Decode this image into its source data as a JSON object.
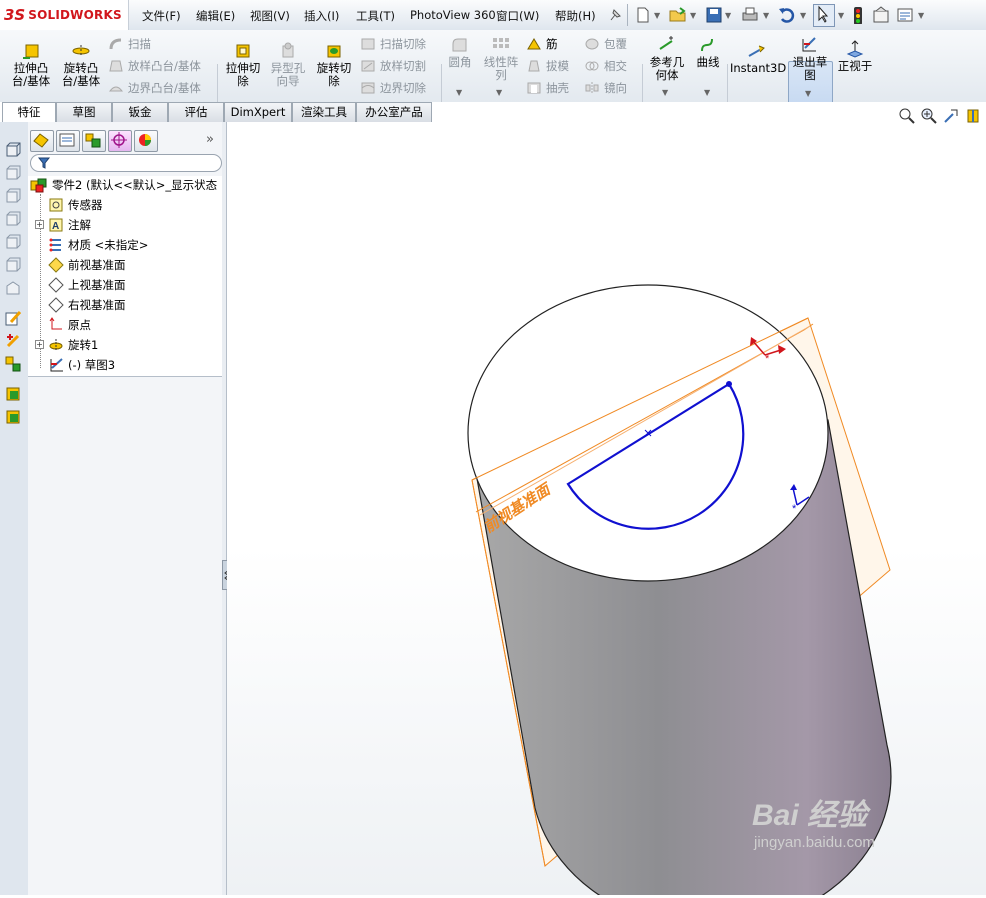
{
  "app": {
    "logo_mark": "3S",
    "brand": "SOLIDWORKS"
  },
  "menu": [
    "文件(F)",
    "编辑(E)",
    "视图(V)",
    "插入(I)",
    "工具(T)",
    "PhotoView 360",
    "窗口(W)",
    "帮助(H)"
  ],
  "ribbon": {
    "extrude_boss": "拉伸凸\n台/基体",
    "revolve_boss": "旋转凸\n台/基体",
    "sweep": "扫描",
    "loft_boss": "放样凸台/基体",
    "boundary_boss": "边界凸台/基体",
    "extrude_cut": "拉伸切\n除",
    "hole_wizard": "异型孔\n向导",
    "revolve_cut": "旋转切\n除",
    "sweep_cut": "扫描切除",
    "loft_cut": "放样切割",
    "boundary_cut": "边界切除",
    "fillet": "圆角",
    "linear_pattern": "线性阵\n列",
    "rib": "筋",
    "draft": "拔模",
    "shell": "抽壳",
    "wrap": "包覆",
    "intersect": "相交",
    "mirror": "镜向",
    "ref_geometry": "参考几\n何体",
    "curves": "曲线",
    "instant3d": "Instant3D",
    "exit_sketch": "退出草\n图",
    "normal_to": "正视于"
  },
  "tabs": [
    "特征",
    "草图",
    "钣金",
    "评估",
    "DimXpert",
    "渲染工具",
    "办公室产品"
  ],
  "active_tab": "特征",
  "tree": {
    "root": "零件2 (默认<<默认>_显示状态",
    "items": [
      {
        "label": "传感器",
        "icon": "sensor-icon",
        "expandable": false
      },
      {
        "label": "注解",
        "icon": "annotation-icon",
        "expandable": true
      },
      {
        "label": "材质 <未指定>",
        "icon": "material-icon",
        "expandable": false
      },
      {
        "label": "前视基准面",
        "icon": "plane-icon",
        "expandable": false
      },
      {
        "label": "上视基准面",
        "icon": "plane-icon",
        "expandable": false
      },
      {
        "label": "右视基准面",
        "icon": "plane-icon",
        "expandable": false
      },
      {
        "label": "原点",
        "icon": "origin-icon",
        "expandable": false
      },
      {
        "label": "旋转1",
        "icon": "revolve-icon",
        "expandable": true
      },
      {
        "label": "(-) 草图3",
        "icon": "sketch-icon",
        "expandable": false
      }
    ]
  },
  "graphics": {
    "plane_label": "前视基准面",
    "colors": {
      "plane": "#f08a24",
      "sketch": "#1010d0",
      "accent_red": "#d1161c"
    }
  },
  "watermark": {
    "brand": "Bai 经验",
    "url": "jingyan.baidu.com"
  }
}
